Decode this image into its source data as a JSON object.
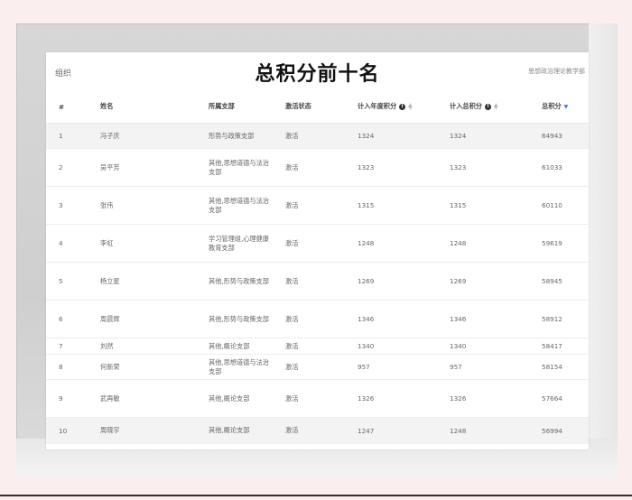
{
  "header": {
    "org_label": "组织",
    "title": "总积分前十名",
    "org_name": "思想政治理论教学部"
  },
  "table": {
    "columns": {
      "index": "#",
      "name": "姓名",
      "branch": "所属支部",
      "status": "激活状态",
      "year_points": "计入年度积分",
      "total_points": "计入总积分",
      "score": "总积分"
    },
    "rows": [
      {
        "index": "1",
        "name": "冯子庆",
        "branch": "形势与政策支部",
        "status": "激活",
        "year": "1324",
        "total": "1324",
        "score": "64943"
      },
      {
        "index": "2",
        "name": "吴平芳",
        "branch": "其他,思想道德与法治支部",
        "status": "激活",
        "year": "1323",
        "total": "1323",
        "score": "61033"
      },
      {
        "index": "3",
        "name": "张伟",
        "branch": "其他,思想道德与法治支部",
        "status": "激活",
        "year": "1315",
        "total": "1315",
        "score": "60110"
      },
      {
        "index": "4",
        "name": "李虹",
        "branch": "学习管理组,心理健康教育支部",
        "status": "激活",
        "year": "1248",
        "total": "1248",
        "score": "59619"
      },
      {
        "index": "5",
        "name": "杨立星",
        "branch": "其他,形势与政策支部",
        "status": "激活",
        "year": "1269",
        "total": "1269",
        "score": "58945"
      },
      {
        "index": "6",
        "name": "周晨辉",
        "branch": "其他,形势与政策支部",
        "status": "激活",
        "year": "1346",
        "total": "1346",
        "score": "58912"
      },
      {
        "index": "7",
        "name": "刘然",
        "branch": "其他,概论支部",
        "status": "激活",
        "year": "1340",
        "total": "1340",
        "score": "58417"
      },
      {
        "index": "8",
        "name": "何新荣",
        "branch": "其他,思想道德与法治支部",
        "status": "激活",
        "year": "957",
        "total": "957",
        "score": "58154"
      },
      {
        "index": "9",
        "name": "武再敏",
        "branch": "其他,概论支部",
        "status": "激活",
        "year": "1326",
        "total": "1326",
        "score": "57664"
      },
      {
        "index": "10",
        "name": "周晓宇",
        "branch": "其他,概论支部",
        "status": "激活",
        "year": "1247",
        "total": "1248",
        "score": "56994"
      }
    ]
  },
  "colors": {
    "sort_active": "#3a7bd5",
    "row_highlight": "#f3f3f3"
  },
  "icons": {
    "info": "info-circle-icon",
    "sort": "sort-arrows-icon",
    "sort_active": "sort-down-icon"
  }
}
